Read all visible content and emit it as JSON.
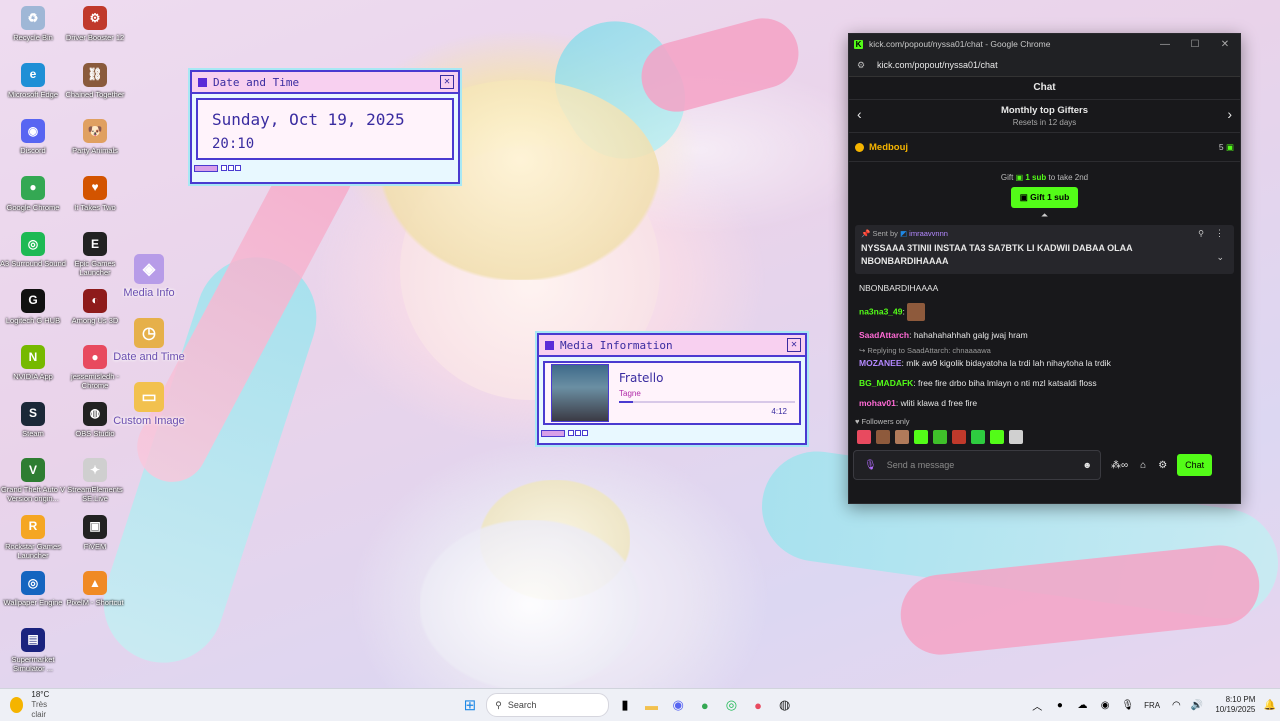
{
  "desktop": {
    "icons": [
      {
        "label": "Recycle Bin",
        "glyph": "♻",
        "color": "#9fb7d6"
      },
      {
        "label": "Driver Booster 12",
        "glyph": "⚙",
        "color": "#c0392b"
      },
      {
        "label": "Microsoft Edge",
        "glyph": "e",
        "color": "#1f8fd6"
      },
      {
        "label": "Chained Together",
        "glyph": "⛓",
        "color": "#8a5a3c"
      },
      {
        "label": "Discord",
        "glyph": "◉",
        "color": "#5865f2"
      },
      {
        "label": "Party Animals",
        "glyph": "🐶",
        "color": "#e0a060"
      },
      {
        "label": "Google Chrome",
        "glyph": "●",
        "color": "#34a853"
      },
      {
        "label": "It Takes Two",
        "glyph": "♥",
        "color": "#d35400"
      },
      {
        "label": "A3 Surround Sound",
        "glyph": "◎",
        "color": "#1db954"
      },
      {
        "label": "Epic Games Launcher",
        "glyph": "E",
        "color": "#222"
      },
      {
        "label": "Logitech G HUB",
        "glyph": "G",
        "color": "#111"
      },
      {
        "label": "Among Us 3D",
        "glyph": "◐",
        "color": "#8e1b1b"
      },
      {
        "label": "NVIDIA App",
        "glyph": "N",
        "color": "#76b900"
      },
      {
        "label": "jessemisledh - Chrome",
        "glyph": "●",
        "color": "#e84a5f"
      },
      {
        "label": "Steam",
        "glyph": "S",
        "color": "#1b2838"
      },
      {
        "label": "OBS Studio",
        "glyph": "◍",
        "color": "#222"
      },
      {
        "label": "Grand Theft Auto V Version origin...",
        "glyph": "V",
        "color": "#2e7d32"
      },
      {
        "label": "StreamElements SE.Live",
        "glyph": "✦",
        "color": "#cfcfcf"
      },
      {
        "label": "Rockstar Games Launcher",
        "glyph": "R",
        "color": "#f5a623"
      },
      {
        "label": "FiVEM",
        "glyph": "▣",
        "color": "#222"
      },
      {
        "label": "Wallpaper Engine",
        "glyph": "◎",
        "color": "#1565c0"
      },
      {
        "label": "PixelM - Shortcut",
        "glyph": "▲",
        "color": "#f08a24"
      },
      {
        "label": "Supermarket Simulator ...",
        "glyph": "▤",
        "color": "#1a237e"
      }
    ],
    "widgets": [
      {
        "label": "Media Info",
        "glyph": "◈",
        "color": "#b79ce8"
      },
      {
        "label": "Date and Time",
        "glyph": "◷",
        "color": "#e6b04a"
      },
      {
        "label": "Custom Image",
        "glyph": "▭",
        "color": "#f2c14e"
      }
    ]
  },
  "date_widget": {
    "title": "Date and Time",
    "date": "Sunday, Oct 19, 2025",
    "time": "20:10"
  },
  "media_widget": {
    "title": "Media Information",
    "track": "Fratello",
    "artist": "Tagne",
    "duration": "4:12",
    "progress": 0.08
  },
  "chrome": {
    "window_title": "kick.com/popout/nyssa01/chat - Google Chrome",
    "url": "kick.com/popout/nyssa01/chat",
    "chat_header": "Chat",
    "gifters_title": "Monthly top Gifters",
    "gifters_subtitle": "Resets in 12 days",
    "top_gifter": {
      "name": "Medbouj",
      "count": "5"
    },
    "gift_prompt_pre": "Gift",
    "gift_prompt_amount": "1 sub",
    "gift_prompt_post": "to take 2nd",
    "gift_button": "Gift 1 sub",
    "pinned": {
      "sent_by_label": "Sent by",
      "sender": "imraavvnnn",
      "text": "NYSSAAA 3TINII INSTAA TA3 SA7BTK LI KADWII DABAA OLAA NBONBARDIHAAAA"
    },
    "messages": [
      {
        "user": "",
        "color": "#e6e6e6",
        "text": "NBONBARDIHAAAA"
      },
      {
        "user": "na3na3_49",
        "color": "#53fc18",
        "text": ""
      },
      {
        "user": "SaadAttarch",
        "color": "#ff6ad5",
        "text": "hahahahahhah galg jwaj hram"
      },
      {
        "user": "MOZANEE",
        "color": "#b388ff",
        "text": "mlk aw9 kigolik bidayatoha la trdi lah nihaytoha la trdik",
        "reply": "Replying to SaadAttarch: chnaaaawa"
      },
      {
        "user": "BG_MADAFK",
        "color": "#53fc18",
        "text": "free fire drbo biha lmlayn o nti mzl katsaldi floss"
      },
      {
        "user": "mohav01",
        "color": "#ff6ad5",
        "text": "wliti klawa d free fire"
      }
    ],
    "followers_only": "Followers only",
    "input_placeholder": "Send a message",
    "chat_button": "Chat"
  },
  "taskbar": {
    "weather_temp": "18°C",
    "weather_desc": "Très clair",
    "search_placeholder": "Search",
    "language": "FRA",
    "time": "8:10 PM",
    "date": "10/19/2025"
  }
}
